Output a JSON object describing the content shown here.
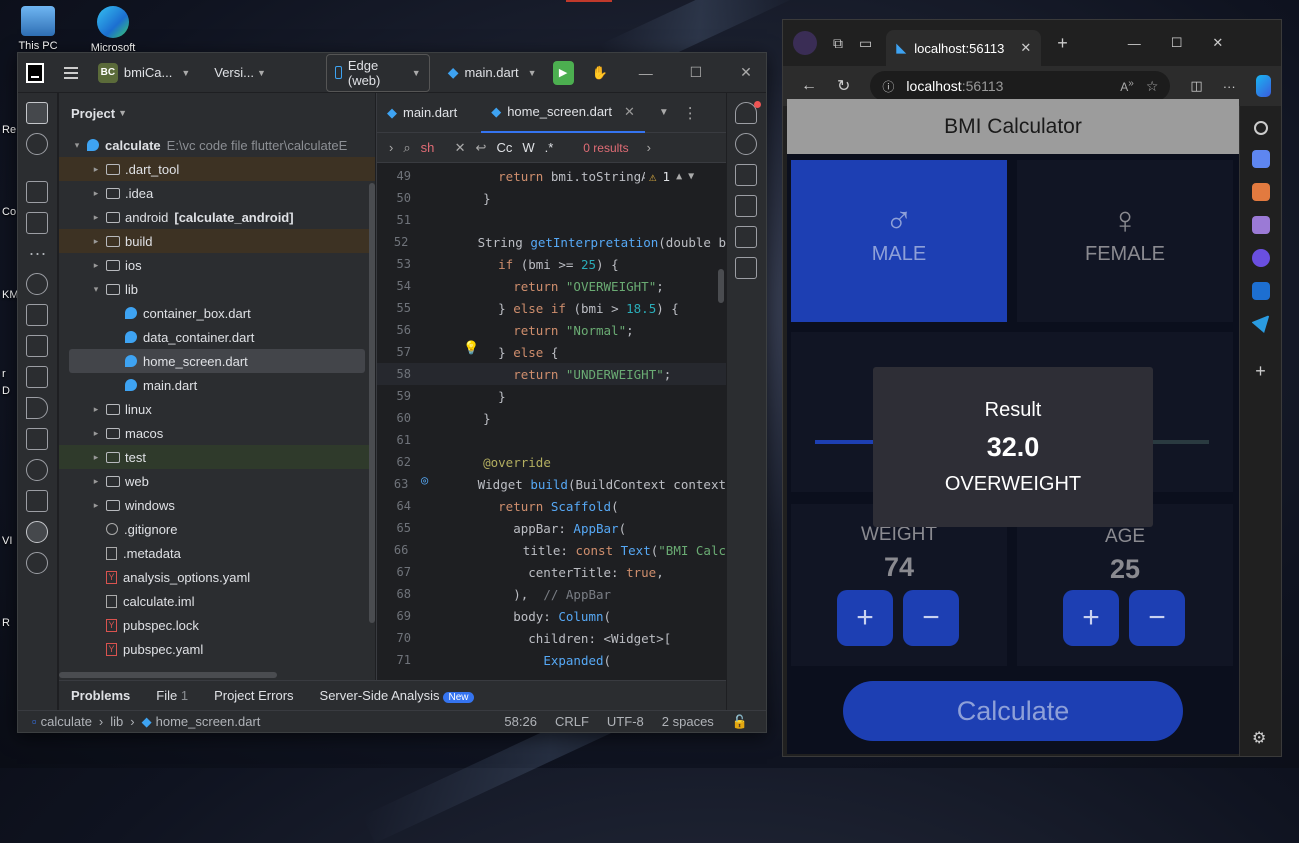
{
  "desktop": {
    "icons": [
      {
        "label": "This PC"
      },
      {
        "label": "Microsoft"
      }
    ],
    "side_labels": [
      "Re",
      "Co",
      "KM",
      "r",
      "D",
      "VI",
      "R"
    ]
  },
  "ide": {
    "project_badge": "BC",
    "project_name": "bmiCa...",
    "vcs": "Versi...",
    "device": "Edge (web)",
    "run_config": "main.dart",
    "panel_title": "Project",
    "tree": [
      {
        "label": "calculate",
        "extra": "E:\\vc code file flutter\\calculateE",
        "indent": 0,
        "icon": "dart",
        "arrow": "▾",
        "style": "root"
      },
      {
        "label": ".dart_tool",
        "indent": 1,
        "icon": "folder",
        "arrow": "▸",
        "style": "excl"
      },
      {
        "label": ".idea",
        "indent": 1,
        "icon": "folder",
        "arrow": "▸",
        "style": ""
      },
      {
        "label": "android",
        "extra": "[calculate_android]",
        "indent": 1,
        "icon": "folder",
        "arrow": "▸",
        "style": "bold-extra"
      },
      {
        "label": "build",
        "indent": 1,
        "icon": "folder",
        "arrow": "▸",
        "style": "excl"
      },
      {
        "label": "ios",
        "indent": 1,
        "icon": "folder",
        "arrow": "▸",
        "style": ""
      },
      {
        "label": "lib",
        "indent": 1,
        "icon": "folder",
        "arrow": "▾",
        "style": ""
      },
      {
        "label": "container_box.dart",
        "indent": 2,
        "icon": "dart",
        "arrow": "",
        "style": ""
      },
      {
        "label": "data_container.dart",
        "indent": 2,
        "icon": "dart",
        "arrow": "",
        "style": ""
      },
      {
        "label": "home_screen.dart",
        "indent": 2,
        "icon": "dart",
        "arrow": "",
        "style": "sel"
      },
      {
        "label": "main.dart",
        "indent": 2,
        "icon": "dart",
        "arrow": "",
        "style": ""
      },
      {
        "label": "linux",
        "indent": 1,
        "icon": "folder",
        "arrow": "▸",
        "style": ""
      },
      {
        "label": "macos",
        "indent": 1,
        "icon": "folder",
        "arrow": "▸",
        "style": ""
      },
      {
        "label": "test",
        "indent": 1,
        "icon": "folder",
        "arrow": "▸",
        "style": "test"
      },
      {
        "label": "web",
        "indent": 1,
        "icon": "folder",
        "arrow": "▸",
        "style": ""
      },
      {
        "label": "windows",
        "indent": 1,
        "icon": "folder",
        "arrow": "▸",
        "style": ""
      },
      {
        "label": ".gitignore",
        "indent": 1,
        "icon": "circ",
        "arrow": "",
        "style": ""
      },
      {
        "label": ".metadata",
        "indent": 1,
        "icon": "file",
        "arrow": "",
        "style": ""
      },
      {
        "label": "analysis_options.yaml",
        "indent": 1,
        "icon": "yml",
        "arrow": "",
        "style": ""
      },
      {
        "label": "calculate.iml",
        "indent": 1,
        "icon": "file",
        "arrow": "",
        "style": ""
      },
      {
        "label": "pubspec.lock",
        "indent": 1,
        "icon": "yml",
        "arrow": "",
        "style": ""
      },
      {
        "label": "pubspec.yaml",
        "indent": 1,
        "icon": "yml",
        "arrow": "",
        "style": ""
      }
    ],
    "tabs": [
      {
        "label": "main.dart",
        "active": false
      },
      {
        "label": "home_screen.dart",
        "active": true
      }
    ],
    "find": {
      "query": "sh",
      "case": "Cc",
      "word": "W",
      "regex": ".*",
      "results": "0 results"
    },
    "warning_count": "1",
    "code": [
      {
        "n": "49",
        "t": [
          [
            "      ",
            "plain"
          ],
          [
            "return ",
            "kw"
          ],
          [
            "bmi.toStringAs",
            "plain"
          ]
        ]
      },
      {
        "n": "50",
        "t": [
          [
            "    }",
            "plain"
          ]
        ]
      },
      {
        "n": "51",
        "t": [
          [
            "",
            "plain"
          ]
        ]
      },
      {
        "n": "52",
        "t": [
          [
            "    String ",
            "plain"
          ],
          [
            "getInterpretation",
            "fn"
          ],
          [
            "(double b",
            "plain"
          ]
        ]
      },
      {
        "n": "53",
        "t": [
          [
            "      ",
            "plain"
          ],
          [
            "if ",
            "kw"
          ],
          [
            "(bmi >= ",
            "plain"
          ],
          [
            "25",
            "num"
          ],
          [
            ") {",
            "plain"
          ]
        ]
      },
      {
        "n": "54",
        "t": [
          [
            "        ",
            "plain"
          ],
          [
            "return ",
            "kw"
          ],
          [
            "\"OVERWEIGHT\"",
            "str"
          ],
          [
            ";",
            "plain"
          ]
        ]
      },
      {
        "n": "55",
        "t": [
          [
            "      } ",
            "plain"
          ],
          [
            "else if ",
            "kw"
          ],
          [
            "(bmi > ",
            "plain"
          ],
          [
            "18.5",
            "num"
          ],
          [
            ") {",
            "plain"
          ]
        ]
      },
      {
        "n": "56",
        "t": [
          [
            "        ",
            "plain"
          ],
          [
            "return ",
            "kw"
          ],
          [
            "\"Normal\"",
            "str"
          ],
          [
            ";",
            "plain"
          ]
        ]
      },
      {
        "n": "57",
        "t": [
          [
            "      } ",
            "plain"
          ],
          [
            "else ",
            "kw"
          ],
          [
            "{",
            "plain"
          ]
        ]
      },
      {
        "n": "58",
        "t": [
          [
            "        ",
            "plain"
          ],
          [
            "return ",
            "kw"
          ],
          [
            "\"UNDERWEIGHT\"",
            "str"
          ],
          [
            ";",
            "plain"
          ]
        ]
      },
      {
        "n": "59",
        "t": [
          [
            "      }",
            "plain"
          ]
        ]
      },
      {
        "n": "60",
        "t": [
          [
            "    }",
            "plain"
          ]
        ]
      },
      {
        "n": "61",
        "t": [
          [
            "",
            "plain"
          ]
        ]
      },
      {
        "n": "62",
        "t": [
          [
            "    ",
            "plain"
          ],
          [
            "@override",
            "ann"
          ]
        ]
      },
      {
        "n": "63",
        "t": [
          [
            "    Widget ",
            "plain"
          ],
          [
            "build",
            "fn"
          ],
          [
            "(BuildContext context",
            "plain"
          ]
        ]
      },
      {
        "n": "64",
        "t": [
          [
            "      ",
            "plain"
          ],
          [
            "return ",
            "kw"
          ],
          [
            "Scaffold",
            "fn"
          ],
          [
            "(",
            "plain"
          ]
        ]
      },
      {
        "n": "65",
        "t": [
          [
            "        appBar: ",
            "plain"
          ],
          [
            "AppBar",
            "fn"
          ],
          [
            "(",
            "plain"
          ]
        ]
      },
      {
        "n": "66",
        "t": [
          [
            "          title: ",
            "plain"
          ],
          [
            "const ",
            "kw"
          ],
          [
            "Text",
            "fn"
          ],
          [
            "(",
            "plain"
          ],
          [
            "\"BMI Calc",
            "str"
          ]
        ]
      },
      {
        "n": "67",
        "t": [
          [
            "          centerTitle: ",
            "plain"
          ],
          [
            "true",
            "kw"
          ],
          [
            ",",
            "plain"
          ]
        ]
      },
      {
        "n": "68",
        "t": [
          [
            "        ), ",
            "plain"
          ],
          [
            " // AppBar",
            "cm"
          ]
        ]
      },
      {
        "n": "69",
        "t": [
          [
            "        body: ",
            "plain"
          ],
          [
            "Column",
            "fn"
          ],
          [
            "(",
            "plain"
          ]
        ]
      },
      {
        "n": "70",
        "t": [
          [
            "          children: <Widget>[",
            "plain"
          ]
        ]
      },
      {
        "n": "71",
        "t": [
          [
            "            ",
            "plain"
          ],
          [
            "Expanded",
            "fn"
          ],
          [
            "(",
            "plain"
          ]
        ]
      }
    ],
    "bottom_tabs": [
      {
        "label": "Problems"
      },
      {
        "label": "File",
        "count": "1"
      },
      {
        "label": "Project Errors"
      },
      {
        "label": "Server-Side Analysis",
        "badge": "New"
      }
    ],
    "status": {
      "crumbs": [
        "calculate",
        "lib",
        "home_screen.dart"
      ],
      "position": "58:26",
      "line_sep": "CRLF",
      "encoding": "UTF-8",
      "indent": "2 spaces"
    }
  },
  "edge": {
    "tab_title": "localhost:56113",
    "url_host": "localhost",
    "url_port": ":56113"
  },
  "app": {
    "title": "BMI Calculator",
    "male": {
      "symbol": "♂",
      "label": "MALE",
      "selected": true
    },
    "female": {
      "symbol": "♀",
      "label": "FEMALE",
      "selected": false
    },
    "weight": {
      "label": "WEIGHT",
      "value": "74"
    },
    "age": {
      "label": "AGE",
      "value": "25"
    },
    "plus": "+",
    "minus": "−",
    "calculate": "Calculate",
    "dialog": {
      "title": "Result",
      "bmi": "32.0",
      "interpretation": "OVERWEIGHT"
    },
    "colors": {
      "selected": "#1d3fb3",
      "card": "#111524",
      "background": "#0b0f1d"
    }
  }
}
